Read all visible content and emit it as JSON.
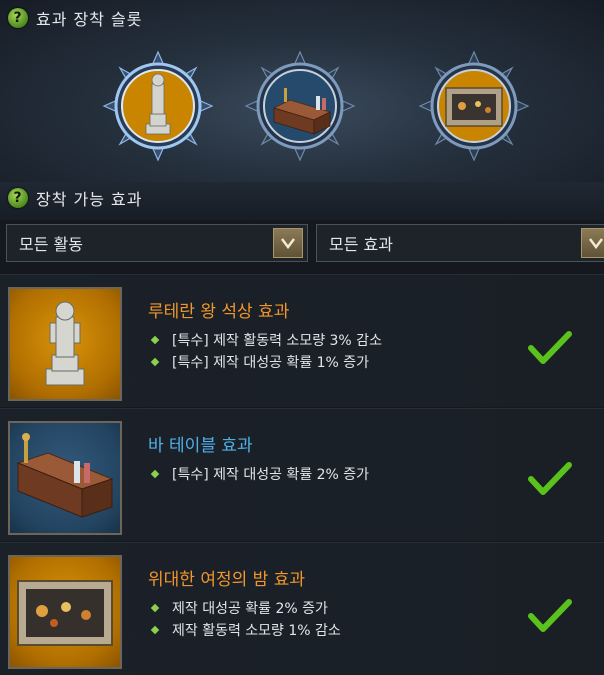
{
  "equip_section": {
    "title": "효과 장착 슬롯",
    "slots": [
      {
        "name": "statue",
        "selected": true
      },
      {
        "name": "bar-table",
        "selected": false
      },
      {
        "name": "painting",
        "selected": false
      }
    ]
  },
  "available_section": {
    "title": "장착 가능 효과"
  },
  "filters": {
    "activity": "모든 활동",
    "effect": "모든 효과"
  },
  "effects": [
    {
      "title": "루테란 왕 석상 효과",
      "title_color": "#f0962a",
      "lines": [
        "[특수] 제작 활동력 소모량 3% 감소",
        "[특수] 제작 대성공 확률 1% 증가"
      ],
      "equipped": true
    },
    {
      "title": "바 테이블 효과",
      "title_color": "#4fb0e8",
      "lines": [
        "[특수] 제작 대성공 확률 2% 증가"
      ],
      "equipped": true
    },
    {
      "title": "위대한 여정의 밤 효과",
      "title_color": "#f0962a",
      "lines": [
        "제작 대성공 확률 2% 증가",
        "제작 활동력 소모량 1% 감소"
      ],
      "equipped": true
    }
  ],
  "colors": {
    "accent_orange": "#f0962a",
    "accent_blue": "#4fb0e8",
    "check_green": "#5ac21a"
  }
}
